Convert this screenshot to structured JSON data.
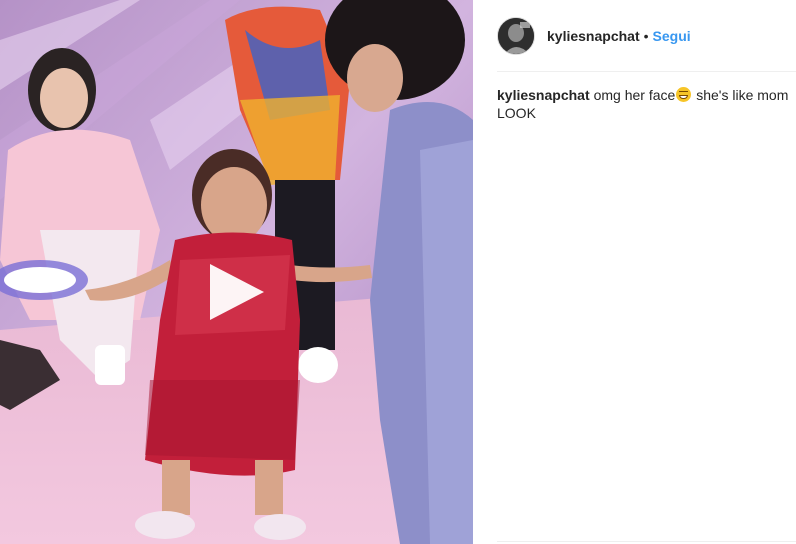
{
  "post": {
    "username": "kyliesnapchat",
    "separator": "•",
    "follow_label": "Segui",
    "caption_user": "kyliesnapchat",
    "caption_text_before": "omg her face",
    "caption_emoji": "grinning-squinting-face-emoji",
    "caption_text_after": " she's like mom LOOK"
  },
  "media": {
    "type": "video",
    "icon": "play-icon"
  },
  "colors": {
    "follow": "#3897f0",
    "text": "#262626",
    "divider": "#efefef"
  }
}
